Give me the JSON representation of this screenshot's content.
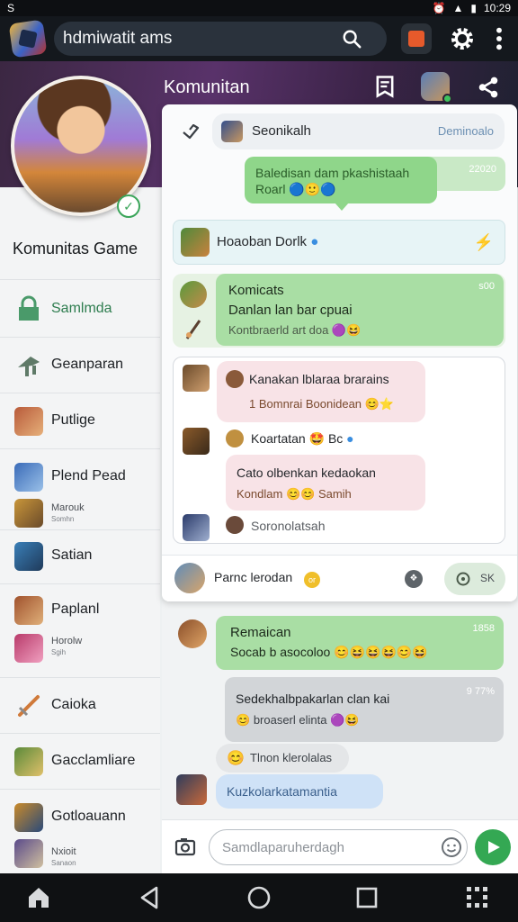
{
  "status_bar": {
    "left_icon": "S",
    "time": "10:29"
  },
  "top_bar": {
    "search_value": "hdmiwatit ams"
  },
  "header": {
    "title": "Komunitan"
  },
  "sidebar": {
    "title": "Komunitas Game",
    "items": [
      {
        "label": "Samlmda",
        "icon": "store-icon",
        "color": "#4a9a6a"
      },
      {
        "label": "Geanparan",
        "icon": "tree-icon",
        "color": "#5f7a68"
      },
      {
        "label": "Putlige",
        "icon": "avatar-game",
        "color": "#b85a3a"
      },
      {
        "label": "Plend Pead",
        "icon": "avatar-game",
        "color": "#3a6bb8"
      },
      {
        "sub": "Marouk",
        "sub2": "Somhn",
        "icon": "avatar-game",
        "color": "#c9963a"
      },
      {
        "label": "Satian",
        "icon": "avatar-game",
        "color": "#3a7fb8"
      },
      {
        "label": "Paplanl",
        "icon": "avatar-game",
        "color": "#a0522d"
      },
      {
        "sub": "Horolw",
        "sub2": "Sgih",
        "icon": "avatar-game",
        "color": "#b83a6a"
      },
      {
        "label": "Caioka",
        "icon": "sword-icon",
        "color": "#d07a3a"
      },
      {
        "label": "Gacclamliare",
        "icon": "avatar-game",
        "color": "#5a8a3a"
      },
      {
        "label": "Gotloauann",
        "icon": "avatar-game",
        "color": "#c98a2a"
      },
      {
        "sub": "Nxioit",
        "sub2": "Sanaon",
        "icon": "avatar-game",
        "color": "#5a4a8a"
      }
    ]
  },
  "card": {
    "search_name": "Seonikalh",
    "search_status": "Deminoalo",
    "bubble_top": {
      "line1": "Baledisan dam pkashistaah",
      "line2": "Roarl",
      "time": "22020"
    },
    "row_tag": "Hoaoban Dorlk",
    "group_msg": {
      "line1": "Komicats",
      "line2": "Danlan lan bar cpuai",
      "line3": "Kontbraerld art doa",
      "time": "s00"
    },
    "thread": {
      "msg1": {
        "line1": "Kanakan lblaraa brarains",
        "line2": "1 Bomnrai Boonidean"
      },
      "msg2": "Koartatan",
      "msg2_badge": "Bc",
      "msg3": {
        "line1": "Cato olbenkan kedaokan",
        "line2": "Kondlam",
        "line2_tail": "Samih"
      },
      "msg4": "Soronolatsah"
    },
    "reply_bar": {
      "name": "Parnc lerodan",
      "coin": "or",
      "pill_label": "SK"
    }
  },
  "chat": {
    "green": {
      "line1": "Remaican",
      "line2": "Socab b asocoloo",
      "time": "1858"
    },
    "gray": {
      "line1": "Sedekhalbpakarlan clan kai",
      "line2": "broaserl elinta",
      "time": "9 77%"
    },
    "small": "Tlnon klerolalas",
    "blue": "Kuzkolarkatamantia"
  },
  "input": {
    "placeholder": "Samdlaparuherdagh"
  },
  "colors": {
    "accent_green": "#34a853",
    "bubble_green": "#a9dea4",
    "header_purple": "#59326a"
  }
}
